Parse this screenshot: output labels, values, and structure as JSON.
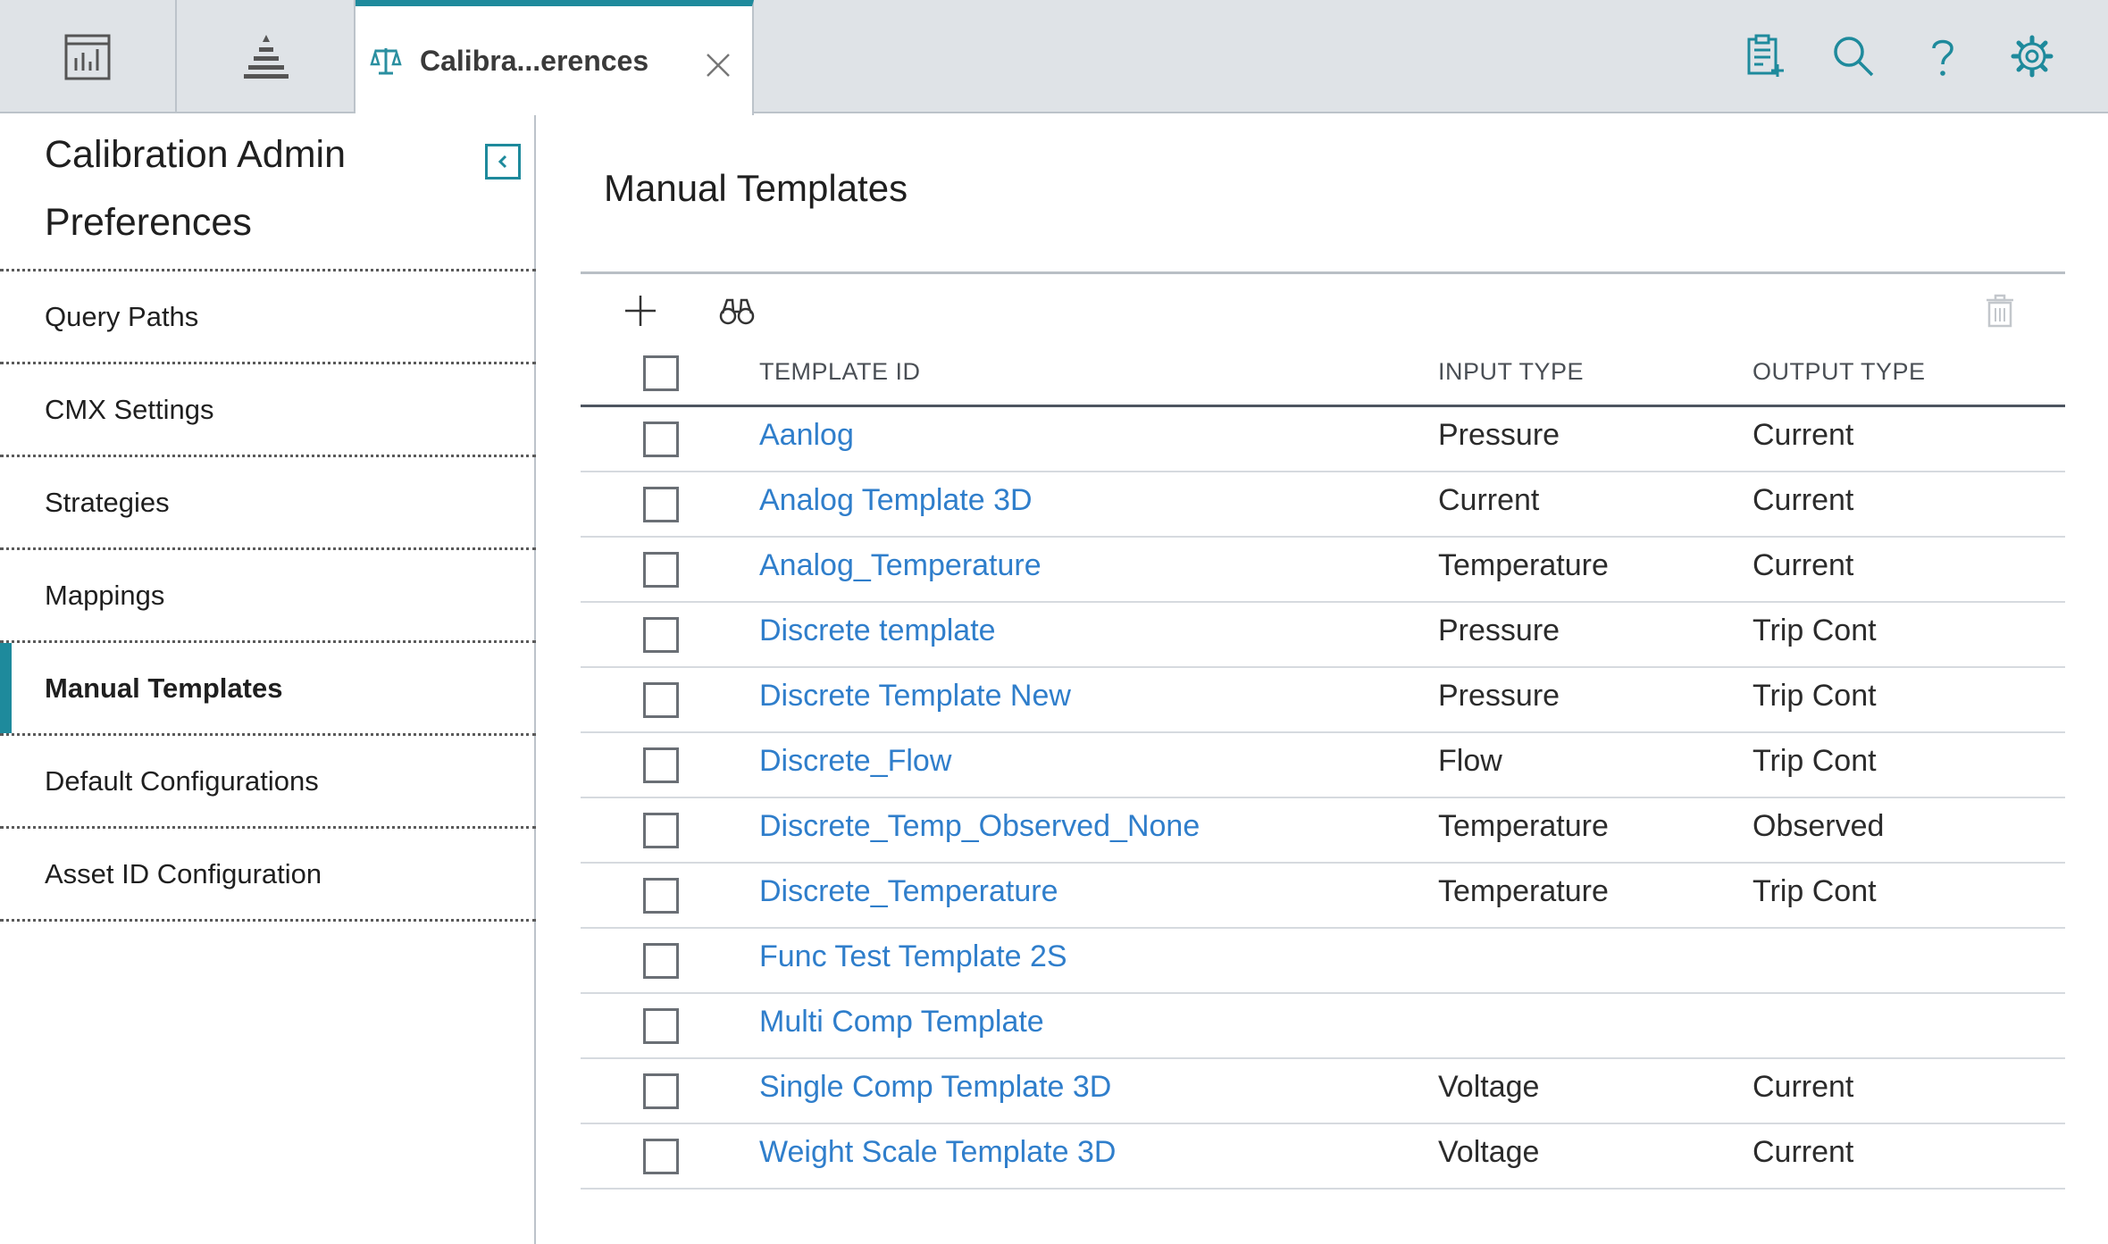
{
  "topbar": {
    "tab_dashboard_icon": "dashboard-chart-icon",
    "tab_hierarchy_icon": "asset-hierarchy-icon",
    "active_tab": {
      "icon": "scales-icon",
      "label": "Calibra...erences",
      "close_icon": "close-icon"
    },
    "actions": [
      {
        "name": "clipboard-add-icon"
      },
      {
        "name": "search-icon"
      },
      {
        "name": "help-icon"
      },
      {
        "name": "gear-icon"
      }
    ]
  },
  "sidebar": {
    "title": "Calibration Admin Preferences",
    "collapse_icon": "chevron-left-icon",
    "items": [
      {
        "label": "Query Paths",
        "active": false
      },
      {
        "label": "CMX Settings",
        "active": false
      },
      {
        "label": "Strategies",
        "active": false
      },
      {
        "label": "Mappings",
        "active": false
      },
      {
        "label": "Manual Templates",
        "active": true
      },
      {
        "label": "Default Configurations",
        "active": false
      },
      {
        "label": "Asset ID Configuration",
        "active": false
      }
    ]
  },
  "main": {
    "title": "Manual Templates",
    "toolbar": {
      "add_icon": "plus-icon",
      "find_icon": "binoculars-icon",
      "delete_icon": "trash-icon"
    },
    "columns": {
      "template_id": "TEMPLATE ID",
      "input_type": "INPUT TYPE",
      "output_type": "OUTPUT TYPE"
    },
    "rows": [
      {
        "template_id": "Aanlog",
        "input_type": "Pressure",
        "output_type": "Current"
      },
      {
        "template_id": "Analog Template 3D",
        "input_type": "Current",
        "output_type": "Current"
      },
      {
        "template_id": "Analog_Temperature",
        "input_type": "Temperature",
        "output_type": "Current"
      },
      {
        "template_id": "Discrete template",
        "input_type": "Pressure",
        "output_type": "Trip Cont"
      },
      {
        "template_id": "Discrete Template New",
        "input_type": "Pressure",
        "output_type": "Trip Cont"
      },
      {
        "template_id": "Discrete_Flow",
        "input_type": "Flow",
        "output_type": "Trip Cont"
      },
      {
        "template_id": "Discrete_Temp_Observed_None",
        "input_type": "Temperature",
        "output_type": "Observed"
      },
      {
        "template_id": "Discrete_Temperature",
        "input_type": "Temperature",
        "output_type": "Trip Cont"
      },
      {
        "template_id": "Func Test Template 2S",
        "input_type": "",
        "output_type": ""
      },
      {
        "template_id": "Multi Comp Template",
        "input_type": "",
        "output_type": ""
      },
      {
        "template_id": "Single Comp Template 3D",
        "input_type": "Voltage",
        "output_type": "Current"
      },
      {
        "template_id": "Weight Scale Template 3D",
        "input_type": "Voltage",
        "output_type": "Current"
      }
    ]
  },
  "colors": {
    "accent": "#1e8a9c",
    "link": "#2f7ecb",
    "topbar_bg": "#dfe3e7"
  }
}
